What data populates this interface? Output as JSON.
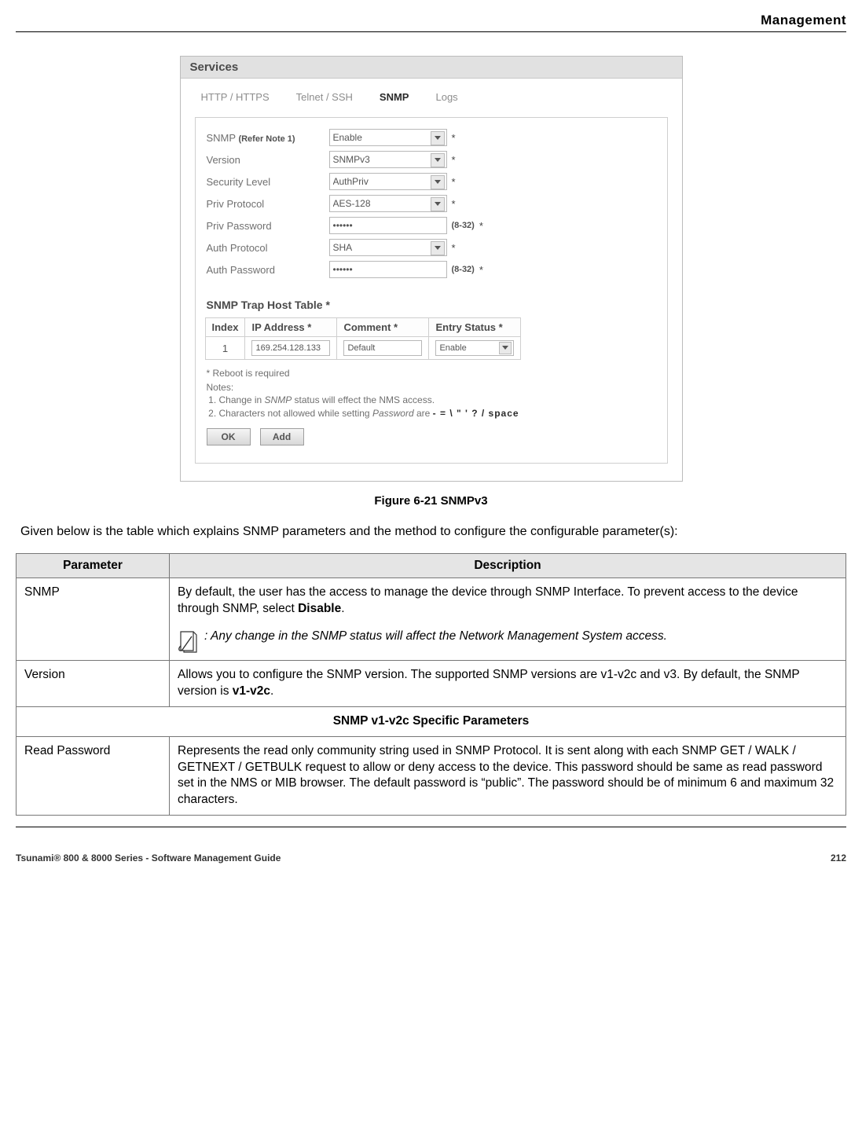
{
  "page": {
    "header": "Management",
    "footer": "Tsunami® 800 & 8000 Series - Software Management Guide",
    "page_number": "212"
  },
  "figure": {
    "caption": "Figure 6-21 SNMPv3",
    "lead_text": "Given below is the table which explains SNMP parameters and the method to configure the configurable parameter(s):"
  },
  "screenshot": {
    "panel_title": "Services",
    "tabs": {
      "t1": "HTTP / HTTPS",
      "t2": "Telnet / SSH",
      "t3": "SNMP",
      "t4": "Logs"
    },
    "form": {
      "snmp_label": "SNMP",
      "snmp_ref": "(Refer Note 1)",
      "snmp_value": "Enable",
      "version_label": "Version",
      "version_value": "SNMPv3",
      "seclevel_label": "Security Level",
      "seclevel_value": "AuthPriv",
      "privproto_label": "Priv Protocol",
      "privproto_value": "AES-128",
      "privpass_label": "Priv Password",
      "privpass_value": "••••••",
      "authproto_label": "Auth Protocol",
      "authproto_value": "SHA",
      "authpass_label": "Auth Password",
      "authpass_value": "••••••",
      "range_hint": "(8-32)"
    },
    "trap_table": {
      "title": "SNMP Trap Host Table *",
      "headers": {
        "h1": "Index",
        "h2": "IP Address *",
        "h3": "Comment *",
        "h4": "Entry Status *"
      },
      "row1": {
        "index": "1",
        "ip": "169.254.128.133",
        "comment": "Default",
        "status": "Enable"
      }
    },
    "notes": {
      "reboot": "* Reboot is required",
      "label": "Notes:",
      "n1_a": "Change in ",
      "n1_em": "SNMP",
      "n1_b": " status will effect the NMS access.",
      "n2_a": "Characters not allowed while setting ",
      "n2_em": "Password",
      "n2_b": " are   ",
      "n2_chars": "-  =  \\  \"  '  ? / space"
    },
    "buttons": {
      "ok": "OK",
      "add": "Add"
    }
  },
  "param_table": {
    "headers": {
      "h1": "Parameter",
      "h2": "Description"
    },
    "r1": {
      "name": "SNMP",
      "desc_a": "By default, the user has the access to manage the device through SNMP Interface. To prevent access to the device through SNMP, select ",
      "desc_bold": "Disable",
      "desc_b": ".",
      "note": ": Any change in the SNMP status will affect the Network Management System access."
    },
    "r2": {
      "name": "Version",
      "desc_a": "Allows you to configure the SNMP version. The supported SNMP versions are v1-v2c and v3. By default, the SNMP version is ",
      "desc_bold": "v1-v2c",
      "desc_b": "."
    },
    "section_heading": "SNMP v1-v2c Specific Parameters",
    "r3": {
      "name": "Read Password",
      "desc": "Represents the read only community string used in SNMP Protocol. It is sent along with each SNMP GET / WALK / GETNEXT / GETBULK request to allow or deny access to the device. This password should be same as read password set in the NMS or MIB browser. The default password is “public”. The password should be of minimum 6 and maximum 32 characters."
    }
  }
}
